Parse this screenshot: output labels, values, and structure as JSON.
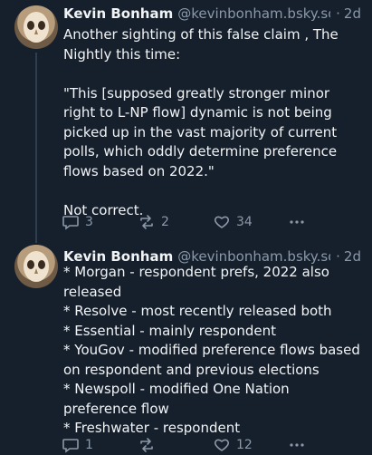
{
  "posts": [
    {
      "author": "Kevin Bonham",
      "handle": "@kevinbonham.bsky.so...",
      "separator": "·",
      "time": "2d",
      "text": "Another sighting of this false claim , The Nightly this time:\n\n\"This [supposed greatly stronger minor right to L-NP flow] dynamic is not being picked up in the vast majority of current polls, which oddly determine preference flows based on 2022.\"\n\nNot correct.",
      "replies": "3",
      "reposts": "2",
      "likes": "34"
    },
    {
      "author": "Kevin Bonham",
      "handle": "@kevinbonham.bsky.so...",
      "separator": "·",
      "time": "2d",
      "text": "* Morgan - respondent prefs, 2022 also released\n* Resolve - most recently released both\n* Essential - mainly respondent\n* YouGov - modified preference flows based on respondent and previous elections\n* Newspoll - modified One Nation preference flow\n* Freshwater - respondent",
      "replies": "1",
      "reposts": "",
      "likes": "12"
    }
  ],
  "icons": {
    "reply": "reply-icon",
    "repost": "repost-icon",
    "like": "heart-icon",
    "more": "more-options-icon"
  },
  "colors": {
    "background": "#16202d",
    "text": "#f1f3f5",
    "muted": "#8b98a8"
  }
}
